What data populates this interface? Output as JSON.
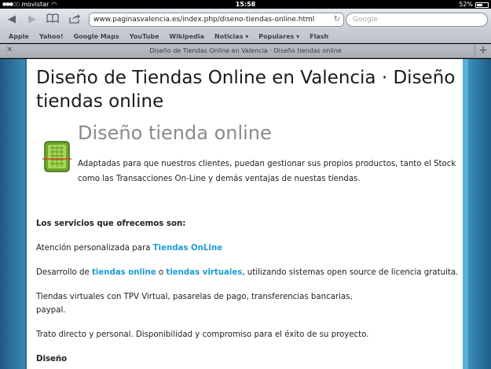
{
  "status": {
    "carrier": "movistar",
    "time": "15:58",
    "battery": "52%",
    "battery_level": 0.52
  },
  "browser": {
    "url": "www.paginasvalencia.es/index.php/diseno-tiendas-online.html",
    "search_placeholder": "Google",
    "bookmarks": [
      "Apple",
      "Yahoo!",
      "Google Maps",
      "YouTube",
      "Wikipedia",
      "Noticias ▾",
      "Populares ▾",
      "Flash"
    ],
    "tab_title": "Diseño de Tiendas Online en Valencia · Diseño tiendas online"
  },
  "page": {
    "title": "Diseño de Tiendas Online en Valencia · Diseño tiendas online",
    "subtitle": "Diseño tienda online",
    "intro": "Adaptadas para que nuestros clientes, puedan gestionar sus propios productos, tanto el Stock como las Transacciones On-Line y demás ventajas de nuestas tiendas.",
    "services_heading": "Los servicios que ofrecemos son:",
    "line1_pre": "Atención personalizada para ",
    "line1_link": "Tiendas OnLine",
    "line2_pre": "Desarrollo de ",
    "line2_link1": "tiendas online",
    "line2_mid": " o ",
    "line2_link2": "tiendas virtuales",
    "line2_post": ", utilizando sistemas open source de licencia gratuita.",
    "line3a": "Tiendas virtuales con TPV Virtual, pasarelas de pago, transferencias bancarias,",
    "line3b": "paypal.",
    "line4": "Trato directo y personal. Disponibilidad y compromiso para el éxito de su proyecto.",
    "section_heading": "Diseño"
  }
}
